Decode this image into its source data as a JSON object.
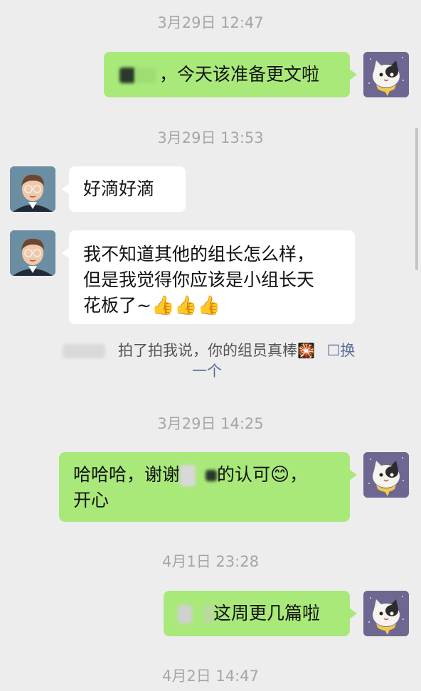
{
  "timestamps": [
    "3月29日 12:47",
    "3月29日 13:53",
    "3月29日 14:25",
    "4月1日 23:28",
    "4月2日 14:47"
  ],
  "messages": {
    "m1": {
      "text": "，今天该准备更文啦"
    },
    "m2": {
      "text": "好滴好滴"
    },
    "m3": {
      "line1": "我不知道其他的组长怎么样，",
      "line2": "但是我觉得你应该是小组长天",
      "line3": "花板了~"
    },
    "m4": {
      "line1a": "哈哈哈，谢谢",
      "line1b": "的认可",
      "line1c": "，",
      "line2": "开心"
    },
    "m5": {
      "text": "这周更几篇啦"
    }
  },
  "pat": {
    "text": "拍了拍我说，你的组员真棒",
    "edit_label": "换",
    "edit_label2": "一个"
  },
  "icons": {
    "thumbs": "thumbs-up-emoji",
    "firework": "firework-emoji",
    "smile": "smile-emoji",
    "edit": "edit-icon"
  },
  "colors": {
    "background": "#ededed",
    "self_bubble": "#a9e97a",
    "peer_bubble": "#ffffff",
    "timestamp": "#a6a6a6",
    "link": "#5b6f9b"
  }
}
